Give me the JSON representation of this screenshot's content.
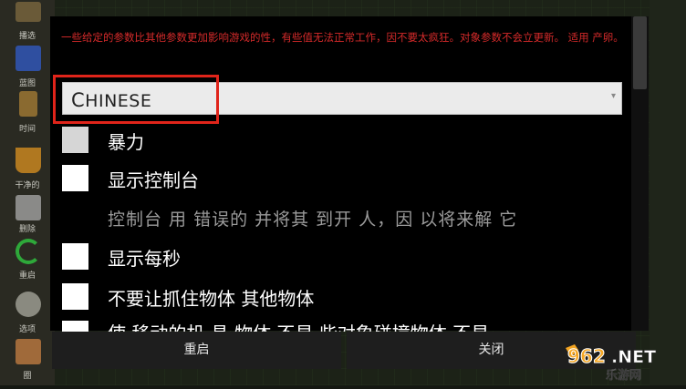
{
  "sidebar": {
    "items": [
      {
        "label": "播选",
        "icon": "select-icon",
        "color": "#7a6a40"
      },
      {
        "label": "蓝图",
        "icon": "blueprint-icon",
        "color": "#2f4fa0"
      },
      {
        "label": "时间",
        "icon": "hourglass-icon",
        "color": "#8a6a30"
      },
      {
        "label": "干净的",
        "icon": "bucket-icon",
        "color": "#b07820"
      },
      {
        "label": "删除",
        "icon": "trash-icon",
        "color": "#8a8a88"
      },
      {
        "label": "重启",
        "icon": "reload-icon",
        "color": "#2ea83a"
      },
      {
        "label": "选项",
        "icon": "gear-icon",
        "color": "#8a8a80"
      },
      {
        "label": "圈",
        "icon": "box-icon",
        "color": "#a06a3a"
      }
    ]
  },
  "dialog": {
    "warning": "一些给定的参数比其他参数更加影响游戏的性，有些值无法正常工作，因不要太疯狂。对象参数不会立更新。 适用 产卵。",
    "language": {
      "value": "Chinese",
      "display": "CHINESE"
    },
    "options": [
      {
        "label": "暴力",
        "checked": false
      },
      {
        "label": "显示控制台",
        "checked": false
      },
      {
        "label": "显示每秒",
        "checked": false
      },
      {
        "label": "不要让抓住物体 其他物体",
        "checked": false
      },
      {
        "label": "使 移动的机 具 物体 不易 些对象碰撞物体 不易",
        "checked": false
      }
    ],
    "console_description": "控制台 用  错误的  并将其 到开 人，因 以将来解 它"
  },
  "buttons": {
    "restart": "重启",
    "close": "关闭"
  },
  "watermark": {
    "main": "962.NET",
    "sub": "乐游网"
  },
  "colors": {
    "warning": "#d42a2a",
    "highlight": "#e0241a",
    "accent": "#f5a623"
  }
}
